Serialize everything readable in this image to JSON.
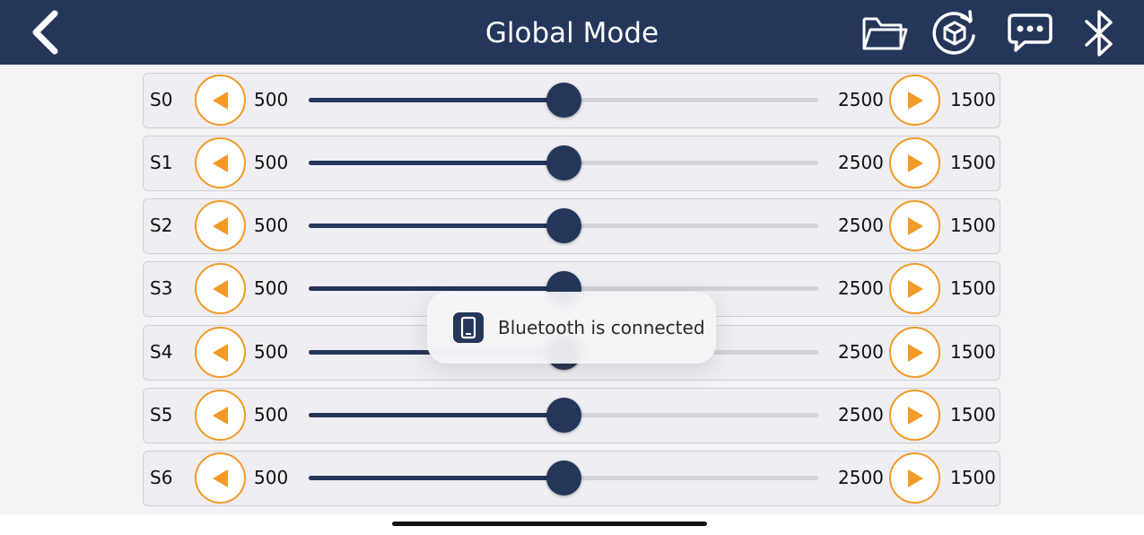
{
  "header": {
    "title": "Global Mode",
    "back_icon": "chevron-left-icon",
    "actions": [
      {
        "name": "folder-icon"
      },
      {
        "name": "rotate-cube-icon"
      },
      {
        "name": "chat-bubble-icon"
      },
      {
        "name": "bluetooth-icon"
      }
    ]
  },
  "colors": {
    "header_bg": "#243659",
    "accent": "#f29a25",
    "slider_fill": "#243659",
    "row_bg": "#eeeef3"
  },
  "servos": [
    {
      "label": "S0",
      "min": "500",
      "max": "2500",
      "value": "1500",
      "level": 0.5
    },
    {
      "label": "S1",
      "min": "500",
      "max": "2500",
      "value": "1500",
      "level": 0.5
    },
    {
      "label": "S2",
      "min": "500",
      "max": "2500",
      "value": "1500",
      "level": 0.5
    },
    {
      "label": "S3",
      "min": "500",
      "max": "2500",
      "value": "1500",
      "level": 0.5
    },
    {
      "label": "S4",
      "min": "500",
      "max": "2500",
      "value": "1500",
      "level": 0.5
    },
    {
      "label": "S5",
      "min": "500",
      "max": "2500",
      "value": "1500",
      "level": 0.5
    },
    {
      "label": "S6",
      "min": "500",
      "max": "2500",
      "value": "1500",
      "level": 0.5
    }
  ],
  "toast": {
    "text": "Bluetooth is connected",
    "icon": "phone-icon"
  }
}
